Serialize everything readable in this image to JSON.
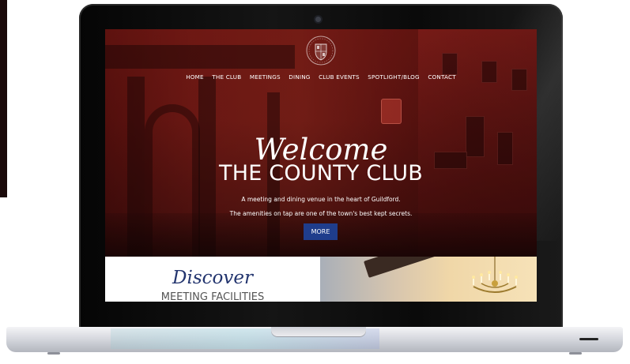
{
  "nav": {
    "items": [
      "HOME",
      "THE CLUB",
      "MEETINGS",
      "DINING",
      "CLUB EVENTS",
      "SPOTLIGHT/BLOG",
      "CONTACT"
    ]
  },
  "hero": {
    "welcome": "Welcome",
    "title": "THE COUNTY CLUB",
    "subtitle_1": "A meeting and dining venue in the heart of Guildford.",
    "subtitle_2": "The amenities on tap are one of the town's best kept secrets.",
    "cta": "MORE"
  },
  "discover": {
    "heading": "Discover",
    "subheading": "MEETING FACILITIES"
  },
  "colors": {
    "hero_overlay": "#6e1a15",
    "cta": "#1f3d8c",
    "discover_heading": "#22346e"
  },
  "icons": [
    "club-crest-icon",
    "camera-icon"
  ]
}
